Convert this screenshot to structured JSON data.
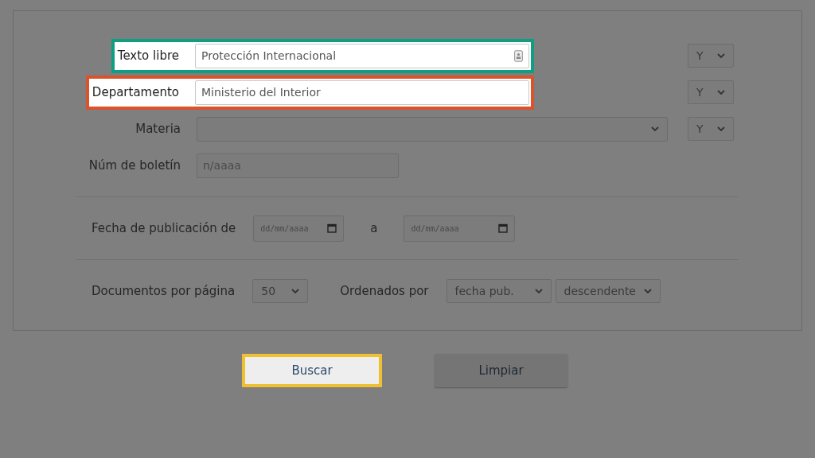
{
  "fields": [
    {
      "kind": "text",
      "label": "Texto libre",
      "value": "Protección Internacional",
      "icon": true,
      "operator": "Y",
      "color": "#0e9e82"
    },
    {
      "kind": "text",
      "label": "Departamento",
      "value": "Ministerio del Interior",
      "operator": "Y",
      "color": "#d9532c"
    },
    {
      "kind": "select",
      "label": "Materia",
      "operator": "Y"
    },
    {
      "kind": "short",
      "label": "Núm de boletín",
      "placeholder": "n/aaaa"
    }
  ],
  "date_range": {
    "label": "Fecha de publicación de",
    "from_placeholder": "dd/mm/aaaa",
    "separator": "a",
    "to_placeholder": "dd/mm/aaaa"
  },
  "paging": {
    "label": "Documentos por página",
    "per_page": "50",
    "order_label": "Ordenados por",
    "order_field": "fecha pub.",
    "order_direction": "descendente"
  },
  "buttons": [
    {
      "label": "Buscar",
      "color": "#f0c030"
    },
    {
      "label": "Limpiar"
    }
  ]
}
